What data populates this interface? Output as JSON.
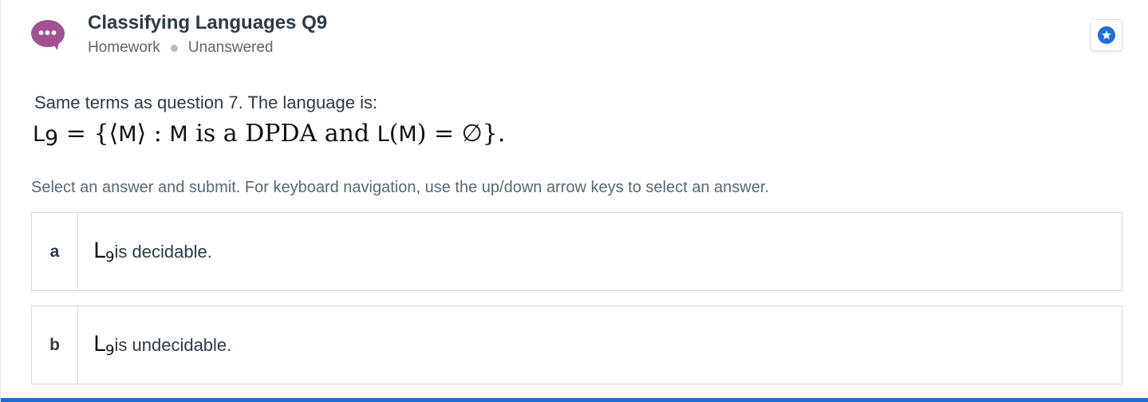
{
  "header": {
    "avatar_glyph": "•••",
    "title": "Classifying Languages Q9",
    "type": "Homework",
    "status": "Unanswered",
    "star_icon": "star-icon",
    "accent_color": "#1e6ee0",
    "avatar_color": "#a2508f"
  },
  "question": {
    "prompt": "Same terms as question 7. The language is:",
    "math": {
      "lhs_var": "L",
      "lhs_sub": "9",
      "eq1": " = {⟨",
      "m1": "M",
      "mid1": "⟩ : ",
      "m2": "M",
      "phrase": " is a DPDA and ",
      "l2": "L",
      "open": "(",
      "m3": "M",
      "close": ") = ∅}."
    }
  },
  "instructions": "Select an answer and submit. For keyboard navigation, use the up/down arrow keys to select an answer.",
  "answers": [
    {
      "letter": "a",
      "var": "L",
      "sub": "9",
      "text": " is decidable."
    },
    {
      "letter": "b",
      "var": "L",
      "sub": "9",
      "text": " is undecidable."
    }
  ]
}
